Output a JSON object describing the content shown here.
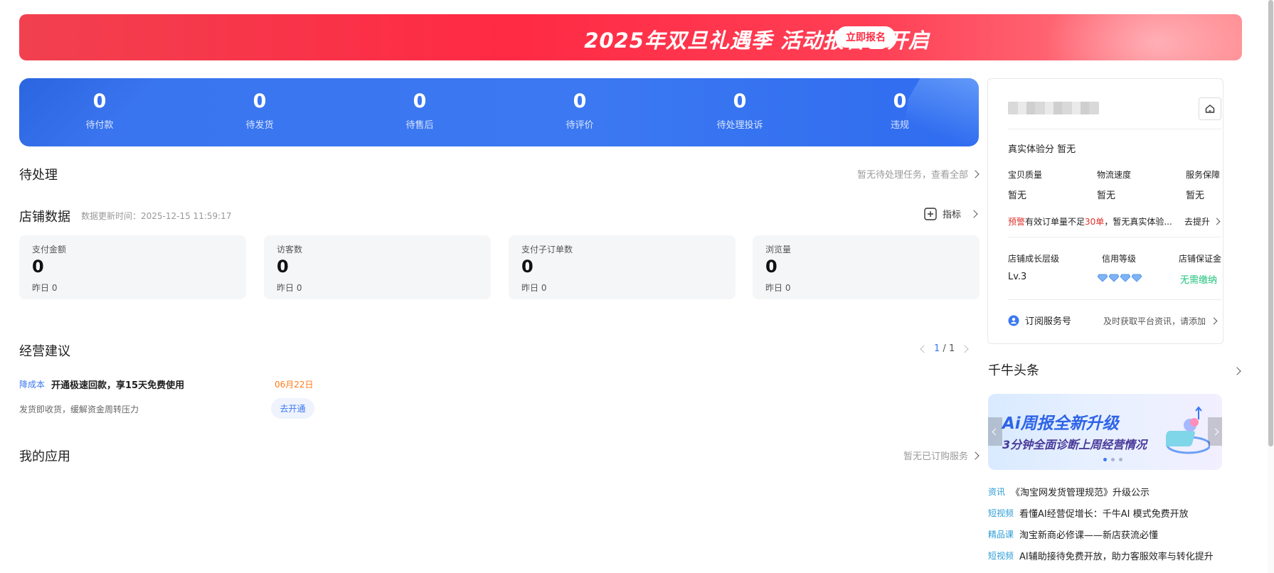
{
  "banner": {
    "title": "2025年双旦礼遇季 活动报名已开启",
    "button": "立即报名"
  },
  "stats": [
    {
      "value": "0",
      "label": "待付款"
    },
    {
      "value": "0",
      "label": "待发货"
    },
    {
      "value": "0",
      "label": "待售后"
    },
    {
      "value": "0",
      "label": "待评价"
    },
    {
      "value": "0",
      "label": "待处理投诉"
    },
    {
      "value": "0",
      "label": "违规"
    }
  ],
  "pending": {
    "title": "待处理",
    "link": "暂无待处理任务，查看全部"
  },
  "shop_data": {
    "title": "店铺数据",
    "update_time": "数据更新时间：2025-12-15 11:59:17",
    "indicator_label": "指标",
    "cards": [
      {
        "title": "支付金额",
        "value": "0",
        "yesterday_label": "昨日",
        "yesterday_value": "0"
      },
      {
        "title": "访客数",
        "value": "0",
        "yesterday_label": "昨日",
        "yesterday_value": "0"
      },
      {
        "title": "支付子订单数",
        "value": "0",
        "yesterday_label": "昨日",
        "yesterday_value": "0"
      },
      {
        "title": "浏览量",
        "value": "0",
        "yesterday_label": "昨日",
        "yesterday_value": "0"
      }
    ]
  },
  "advice": {
    "title": "经营建议",
    "pager": {
      "current": "1",
      "sep": "/",
      "total": "1"
    },
    "item": {
      "tag": "降成本",
      "title": "开通极速回款，享15天免费使用",
      "date": "06月22日",
      "desc": "发货即收货，缓解资金周转压力",
      "button": "去开通"
    }
  },
  "my_apps": {
    "title": "我的应用",
    "link": "暂无已订购服务"
  },
  "panel": {
    "experience_label": "真实体验分",
    "experience_value": "暂无",
    "metrics": [
      {
        "label": "宝贝质量",
        "value": "暂无"
      },
      {
        "label": "物流速度",
        "value": "暂无"
      },
      {
        "label": "服务保障",
        "value": "暂无"
      }
    ],
    "warning": {
      "tag": "预警",
      "text_a": "有效订单量不足",
      "highlight": "30单",
      "text_b": "，暂无真实体验...",
      "link": "去提升"
    },
    "levels": [
      {
        "label": "店铺成长层级",
        "value": "Lv.3"
      },
      {
        "label": "信用等级",
        "diamonds": 4
      },
      {
        "label": "店铺保证金",
        "value": "无需缴纳"
      }
    ],
    "subscribe": {
      "label": "订阅服务号",
      "desc": "及时获取平台资讯，请添加"
    }
  },
  "headlines": {
    "title": "千牛头条",
    "carousel": {
      "line1": "Ai周报全新升级",
      "line2": "3分钟全面诊断上周经营情况"
    },
    "items": [
      {
        "tag": "资讯",
        "text": "《淘宝网发货管理规范》升级公示"
      },
      {
        "tag": "短视频",
        "text": "看懂AI经营促增长：千牛AI 模式免费开放"
      },
      {
        "tag": "精品课",
        "text": "淘宝新商必修课——新店获流必懂"
      },
      {
        "tag": "短视频",
        "text": "AI辅助接待免费开放，助力客服效率与转化提升"
      }
    ]
  },
  "colors": {
    "brand_red": "#ff2a44",
    "brand_blue": "#3b78f1",
    "warning_red": "#e0312a",
    "date_orange": "#ff7a1a",
    "success_green": "#1ec27a",
    "tag_blue": "#2d9dd6"
  }
}
